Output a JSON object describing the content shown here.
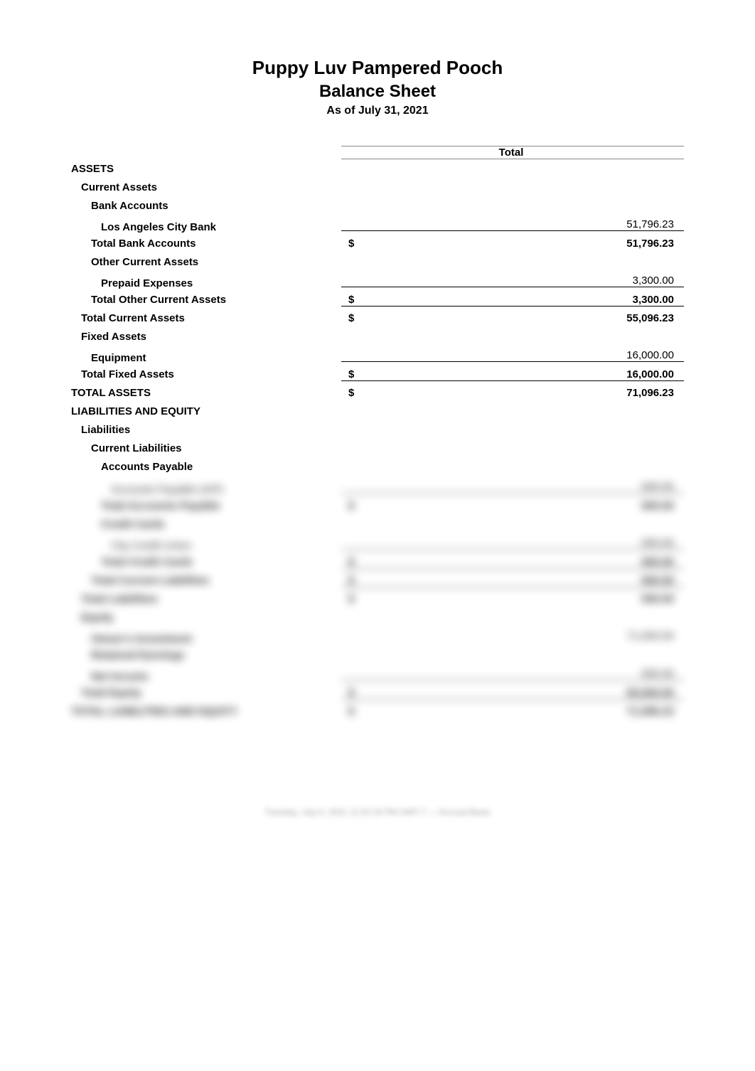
{
  "header": {
    "company": "Puppy Luv Pampered Pooch",
    "title": "Balance Sheet",
    "as_of": "As of July 31, 2021"
  },
  "columns": {
    "total": "Total"
  },
  "rows": {
    "assets": "ASSETS",
    "current_assets": "Current Assets",
    "bank_accounts": "Bank Accounts",
    "la_city_bank": {
      "label": "Los Angeles City Bank",
      "value": "51,796.23"
    },
    "total_bank_accounts": {
      "label": "Total Bank Accounts",
      "currency": "$",
      "value": "51,796.23"
    },
    "other_current_assets": "Other Current Assets",
    "prepaid_expenses": {
      "label": "Prepaid Expenses",
      "value": "3,300.00"
    },
    "total_other_current_assets": {
      "label": "Total Other Current Assets",
      "currency": "$",
      "value": "3,300.00"
    },
    "total_current_assets": {
      "label": "Total Current Assets",
      "currency": "$",
      "value": "55,096.23"
    },
    "fixed_assets": "Fixed Assets",
    "equipment": {
      "label": "Equipment",
      "value": "16,000.00"
    },
    "total_fixed_assets": {
      "label": "Total Fixed Assets",
      "currency": "$",
      "value": "16,000.00"
    },
    "total_assets": {
      "label": "TOTAL ASSETS",
      "currency": "$",
      "value": "71,096.23"
    },
    "liabilities_and_equity": "LIABILITIES AND EQUITY",
    "liabilities": "Liabilities",
    "current_liabilities": "Current Liabilities",
    "accounts_payable": "Accounts Payable"
  },
  "obscured": {
    "r1": {
      "label": "Accounts Payable (A/P)",
      "value": "000.00"
    },
    "r2": {
      "label": "Total Accounts Payable",
      "currency": "$",
      "value": "000.00"
    },
    "r3": {
      "label": "Credit Cards"
    },
    "r4": {
      "label": "City Credit Union",
      "value": "000.00"
    },
    "r5": {
      "label": "Total Credit Cards",
      "currency": "$",
      "value": "000.00"
    },
    "r6": {
      "label": "Total Current Liabilities",
      "currency": "$",
      "value": "000.00"
    },
    "r7": {
      "label": "Total Liabilities",
      "currency": "$",
      "value": "000.00"
    },
    "r8": {
      "label": "Equity"
    },
    "r9": {
      "label": "Owner's Investment",
      "value": "71,000.00"
    },
    "r10": {
      "label": "Retained Earnings"
    },
    "r11": {
      "label": "Net Income",
      "value": "000.00"
    },
    "r12": {
      "label": "Total Equity",
      "currency": "$",
      "value": "00,000.00"
    },
    "r13": {
      "label": "TOTAL LIABILITIES AND EQUITY",
      "currency": "$",
      "value": "71,096.23"
    }
  },
  "footer": "Tuesday, July 6, 2021 11:52:16 PM GMT-7 — Accrual Basis"
}
